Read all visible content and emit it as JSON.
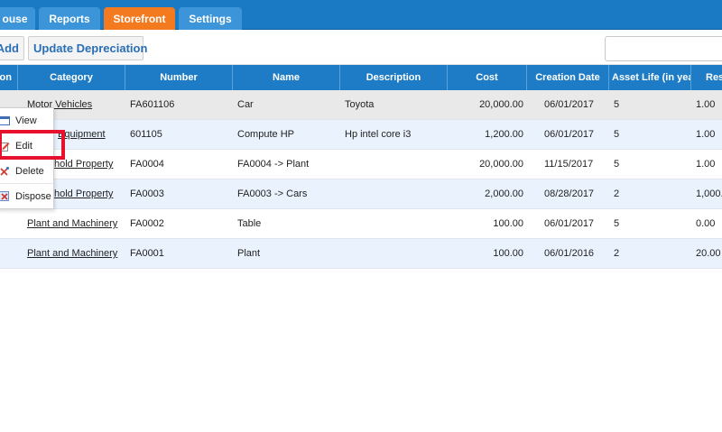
{
  "nav": {
    "tabs": [
      {
        "label": "ouse",
        "active": false
      },
      {
        "label": "Reports",
        "active": false
      },
      {
        "label": "Storefront",
        "active": true
      },
      {
        "label": "Settings",
        "active": false
      }
    ]
  },
  "toolbar": {
    "add_label": "Add",
    "update_label": "Update Depreciation",
    "search_value": ""
  },
  "table": {
    "headers": [
      "on",
      "Category",
      "Number",
      "Name",
      "Description",
      "Cost",
      "Creation Date",
      "Asset Life (in yea",
      "Res"
    ],
    "rows": [
      {
        "category": "Motor Vehicles",
        "number": "FA601106",
        "name": "Car",
        "description": "Toyota",
        "cost": "20,000.00",
        "date": "06/01/2017",
        "life": "5",
        "res": "1.00"
      },
      {
        "category": "Equipment",
        "number": "601105",
        "name": "Compute HP",
        "description": "Hp intel core i3",
        "cost": "1,200.00",
        "date": "06/01/2017",
        "life": "5",
        "res": "1.00"
      },
      {
        "category": "hold Property",
        "number": "FA0004",
        "name": "FA0004 -> Plant",
        "description": "",
        "cost": "20,000.00",
        "date": "11/15/2017",
        "life": "5",
        "res": "1.00"
      },
      {
        "category": "hold Property",
        "number": "FA0003",
        "name": "FA0003 -> Cars",
        "description": "",
        "cost": "2,000.00",
        "date": "08/28/2017",
        "life": "2",
        "res": "1,000."
      },
      {
        "category": "Plant and Machinery",
        "number": "FA0002",
        "name": "Table",
        "description": "",
        "cost": "100.00",
        "date": "06/01/2017",
        "life": "5",
        "res": "0.00"
      },
      {
        "category": "Plant and Machinery",
        "number": "FA0001",
        "name": "Plant",
        "description": "",
        "cost": "100.00",
        "date": "06/01/2016",
        "life": "2",
        "res": "20.00"
      }
    ]
  },
  "context_menu": {
    "items": [
      {
        "label": "View",
        "icon": "view-icon"
      },
      {
        "label": "Edit",
        "icon": "pencil-icon"
      },
      {
        "label": "Delete",
        "icon": "delete-icon"
      },
      {
        "label": "Dispose",
        "icon": "dispose-icon"
      }
    ]
  },
  "colors": {
    "nav_bg": "#1a7ac4",
    "tab_active": "#f37a1f",
    "header_bg": "#1d7cc5",
    "highlight": "#e8112d"
  }
}
